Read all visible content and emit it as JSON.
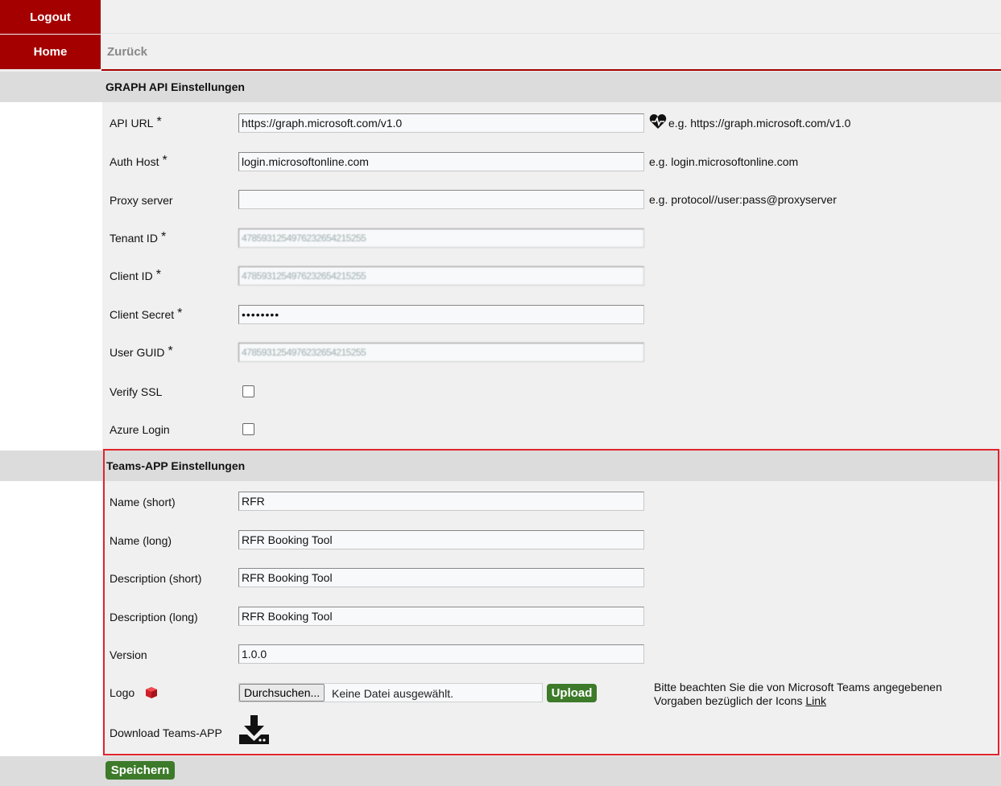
{
  "nav": {
    "logout": "Logout",
    "home": "Home",
    "back": "Zurück"
  },
  "graph": {
    "title": "GRAPH API Einstellungen",
    "required_mark": "*",
    "api_url": {
      "label": "API URL",
      "value": "https://graph.microsoft.com/v1.0",
      "hint": "e.g. https://graph.microsoft.com/v1.0"
    },
    "auth_host": {
      "label": "Auth Host",
      "value": "login.microsoftonline.com",
      "hint": "e.g. login.microsoftonline.com"
    },
    "proxy": {
      "label": "Proxy server",
      "value": "",
      "hint": "e.g. protocol//user:pass@proxyserver"
    },
    "tenant_id": {
      "label": "Tenant ID",
      "value": "4785931254976232654215255"
    },
    "client_id": {
      "label": "Client ID",
      "value": "4785931254976232654215255"
    },
    "client_secret": {
      "label": "Client Secret",
      "value": "••••••••"
    },
    "user_guid": {
      "label": "User GUID",
      "value": "4785931254976232654215255"
    },
    "verify_ssl": {
      "label": "Verify SSL",
      "checked": false
    },
    "azure_login": {
      "label": "Azure Login",
      "checked": false
    }
  },
  "teams": {
    "title": "Teams-APP Einstellungen",
    "name_short": {
      "label": "Name (short)",
      "value": "RFR"
    },
    "name_long": {
      "label": "Name (long)",
      "value": "RFR Booking Tool"
    },
    "desc_short": {
      "label": "Description (short)",
      "value": "RFR Booking Tool"
    },
    "desc_long": {
      "label": "Description (long)",
      "value": "RFR Booking Tool"
    },
    "version": {
      "label": "Version",
      "value": "1.0.0"
    },
    "logo": {
      "label": "Logo",
      "browse": "Durchsuchen...",
      "file_status": "Keine Datei ausgewählt.",
      "upload": "Upload",
      "note": "Bitte beachten Sie die von Microsoft Teams angegebenen Vorgaben bezüglich der Icons",
      "link": "Link"
    },
    "download_label": "Download Teams-APP"
  },
  "save": "Speichern",
  "colors": {
    "nav": "#a50000",
    "green": "#3d7a2a",
    "highlight": "#e0242e"
  }
}
